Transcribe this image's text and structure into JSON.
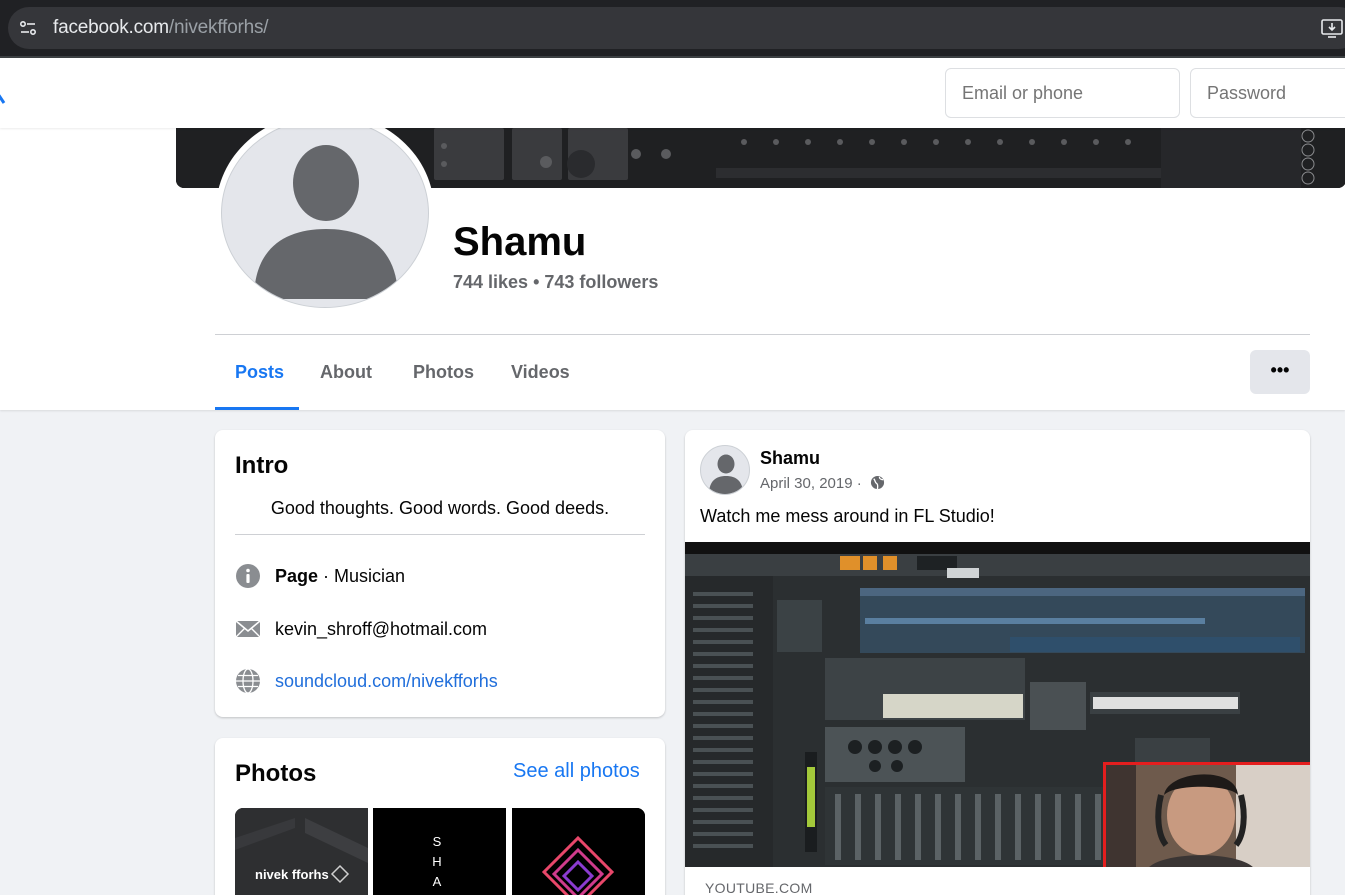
{
  "browser": {
    "url_host": "facebook.com",
    "url_path": "/nivekfforhs/"
  },
  "header": {
    "email_placeholder": "Email or phone",
    "password_placeholder": "Password"
  },
  "profile": {
    "name": "Shamu",
    "stats": "744 likes • 743 followers"
  },
  "tabs": [
    {
      "label": "Posts",
      "active": true
    },
    {
      "label": "About",
      "active": false
    },
    {
      "label": "Photos",
      "active": false
    },
    {
      "label": "Videos",
      "active": false
    }
  ],
  "more_label": "•••",
  "intro": {
    "title": "Intro",
    "bio": "Good thoughts. Good words. Good deeds.",
    "page_label": "Page",
    "page_category": " · Musician",
    "email": "kevin_shroff@hotmail.com",
    "website": "soundcloud.com/nivekfforhs"
  },
  "photos": {
    "title": "Photos",
    "see_all": "See all photos",
    "thumb1_text": "nivek fforhs",
    "thumb2_text": "SHAM"
  },
  "post": {
    "author": "Shamu",
    "date": "April 30, 2019",
    "separator": " · ",
    "text": "Watch me mess around in FL Studio!",
    "link_source": "YOUTUBE.COM"
  },
  "colors": {
    "accent": "#1877f2",
    "highlight_box": "#e41e1e"
  }
}
